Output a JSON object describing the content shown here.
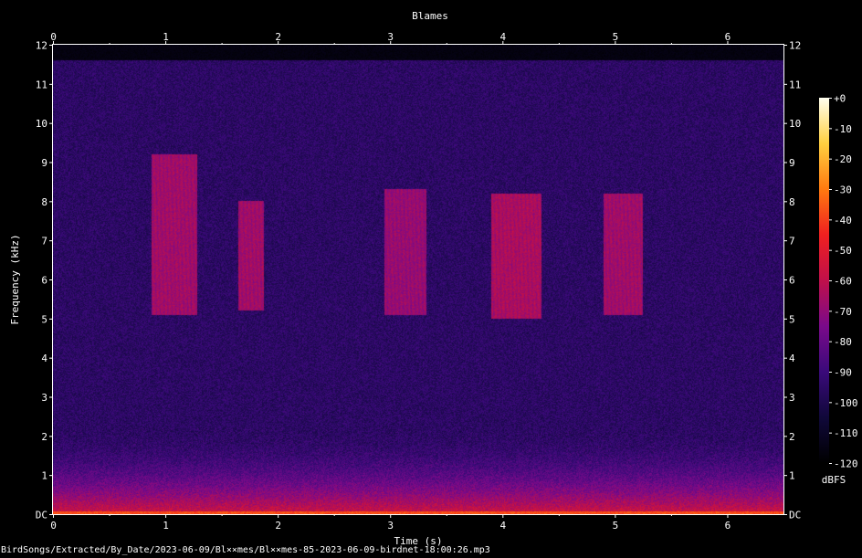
{
  "footer": {
    "file_path": "BirdSongs/Extracted/By_Date/2023-06-09/Bl××mes/Bl××mes-85-2023-06-09-birdnet-18:00:26.mp3"
  },
  "chart_data": {
    "type": "heatmap",
    "title": "Blames",
    "xlabel": "Time (s)",
    "ylabel": "Frequency (kHz)",
    "xlim": [
      0,
      6.5
    ],
    "ylim": [
      0,
      12
    ],
    "x_ticks": [
      "0",
      "1",
      "2",
      "3",
      "4",
      "5",
      "6"
    ],
    "y_ticks": [
      "DC",
      "1",
      "2",
      "3",
      "4",
      "5",
      "6",
      "7",
      "8",
      "9",
      "10",
      "11",
      "12"
    ],
    "colorbar": {
      "label": "dBFS",
      "range": [
        -120,
        0
      ],
      "ticks": [
        "+0",
        "-10",
        "-20",
        "-30",
        "-40",
        "-50",
        "-60",
        "-70",
        "-80",
        "-90",
        "-100",
        "-110",
        "-120"
      ],
      "colors": [
        "#000000",
        "#10083a",
        "#3a0a7a",
        "#7a0a8a",
        "#c0104a",
        "#f02020",
        "#ff7a10",
        "#ffd040",
        "#fffff0"
      ]
    },
    "background_level_dbfs": -95,
    "low_frequency_band": {
      "top_khz": 2.2,
      "peak_dbfs": -55
    },
    "signal_cutoff_khz": 11.6,
    "calls": [
      {
        "start_s": 0.88,
        "end_s": 1.28,
        "low_khz": 5.1,
        "high_khz": 9.2,
        "level_dbfs": -65
      },
      {
        "start_s": 1.65,
        "end_s": 1.88,
        "low_khz": 5.2,
        "high_khz": 8.0,
        "level_dbfs": -65
      },
      {
        "start_s": 2.95,
        "end_s": 3.32,
        "low_khz": 5.1,
        "high_khz": 8.3,
        "level_dbfs": -67
      },
      {
        "start_s": 3.9,
        "end_s": 4.35,
        "low_khz": 5.0,
        "high_khz": 8.2,
        "level_dbfs": -63
      },
      {
        "start_s": 4.9,
        "end_s": 5.25,
        "low_khz": 5.1,
        "high_khz": 8.2,
        "level_dbfs": -65
      }
    ]
  }
}
